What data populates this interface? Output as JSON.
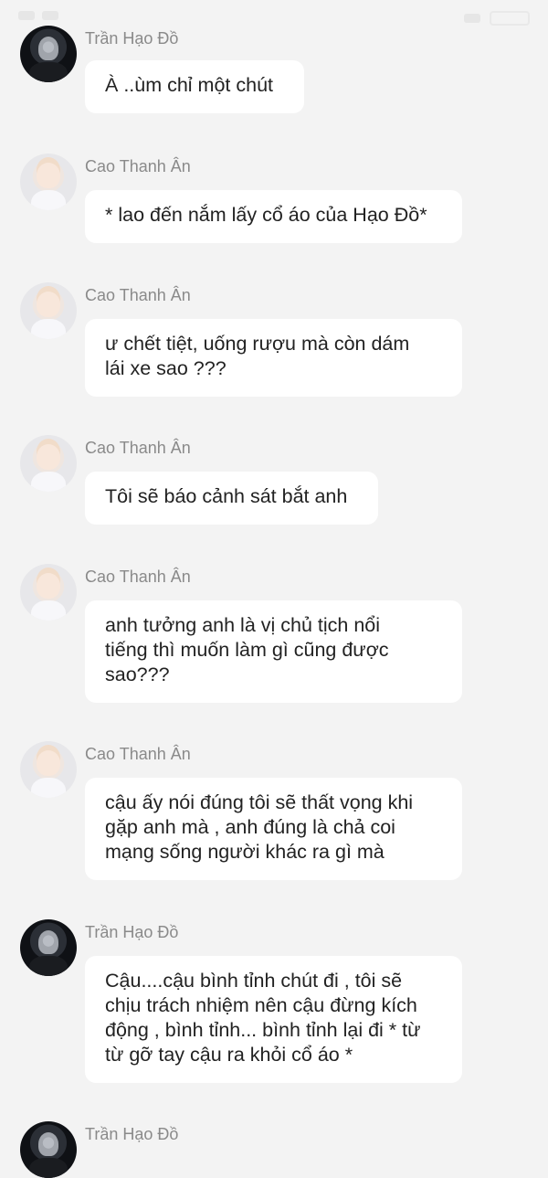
{
  "status_bar": {
    "items": [
      "signal-icon",
      "wifi-icon",
      "battery-icon"
    ]
  },
  "messages": [
    {
      "sender": "Trần Hạo Đồ",
      "avatar": "avatar-tran-hao-do",
      "text": "À ..ùm chỉ một chút"
    },
    {
      "sender": "Cao Thanh Ân",
      "avatar": "avatar-cao-thanh-an",
      "text": "* lao đến nắm lấy cổ áo của Hạo Đồ*"
    },
    {
      "sender": "Cao Thanh Ân",
      "avatar": "avatar-cao-thanh-an",
      "text": "ư chết tiệt, uống rượu mà còn dám\nlái xe sao ???"
    },
    {
      "sender": "Cao Thanh Ân",
      "avatar": "avatar-cao-thanh-an",
      "text": "Tôi sẽ báo cảnh sát bắt anh"
    },
    {
      "sender": "Cao Thanh Ân",
      "avatar": "avatar-cao-thanh-an",
      "text": "anh tưởng anh là vị chủ tịch nổi\ntiếng thì muốn làm gì cũng được\nsao???"
    },
    {
      "sender": "Cao Thanh Ân",
      "avatar": "avatar-cao-thanh-an",
      "text": "cậu ấy nói đúng tôi sẽ thất vọng khi\ngặp anh mà , anh đúng là chả coi\nmạng sống người khác ra gì mà"
    },
    {
      "sender": "Trần Hạo Đồ",
      "avatar": "avatar-tran-hao-do",
      "text": "Cậu....cậu bình tỉnh chút đi , tôi sẽ\nchịu trách nhiệm nên cậu đừng kích\nđộng , bình tỉnh... bình tỉnh lại đi * từ\ntừ gỡ tay cậu ra khỏi cổ áo *"
    },
    {
      "sender": "Trần Hạo Đồ",
      "avatar": "avatar-tran-hao-do",
      "text": ""
    }
  ]
}
